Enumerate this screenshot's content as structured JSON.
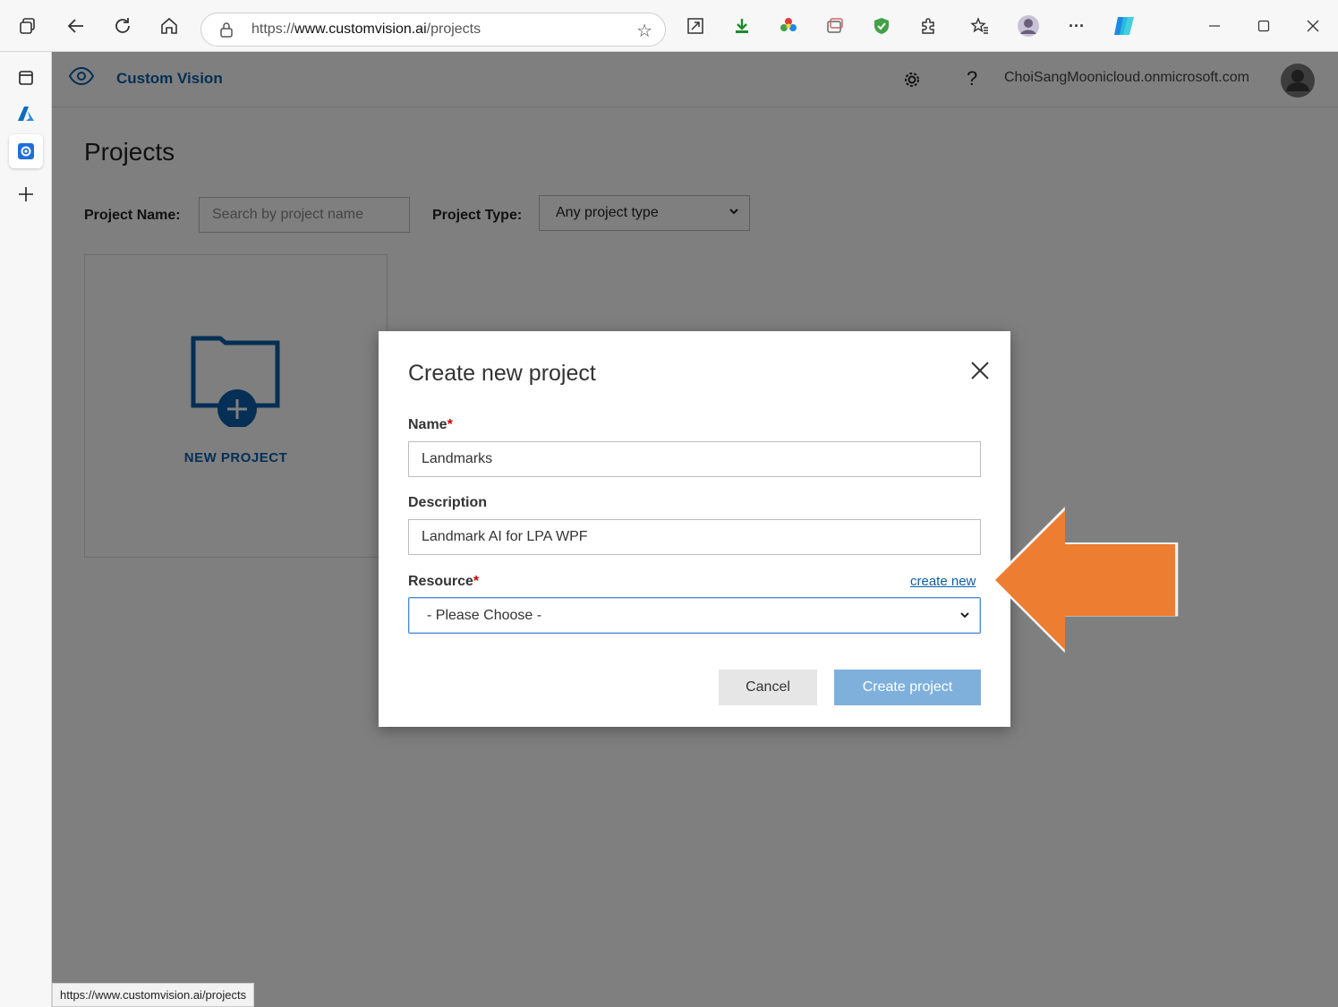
{
  "browser": {
    "url_prefix": "https://",
    "url_domain": "www.customvision.ai",
    "url_path": "/projects",
    "status_url": "https://www.customvision.ai/projects"
  },
  "app": {
    "name": "Custom Vision",
    "user": "ChoiSangMoonicloud.onmicrosoft.com",
    "page_title": "Projects",
    "filter_name_label": "Project Name:",
    "search_placeholder": "Search by project name",
    "filter_type_label": "Project Type:",
    "type_selected": "Any project type",
    "new_project_label": "NEW PROJECT"
  },
  "modal": {
    "title": "Create new project",
    "name_label": "Name",
    "name_value": "Landmarks",
    "description_label": "Description",
    "description_value": "Landmark AI for LPA WPF",
    "resource_label": "Resource",
    "required_mark": "*",
    "create_new_link": "create new",
    "resource_selected": "- Please Choose -",
    "cancel_label": "Cancel",
    "create_label": "Create project"
  },
  "colors": {
    "accent": "#0a5ea8",
    "arrow": "#ed7d31",
    "create_button": "#7fb0dc"
  },
  "icons": [
    "tab-actions-icon",
    "back-icon",
    "refresh-icon",
    "home-icon",
    "lock-icon",
    "favorite-star-icon",
    "expand-icon",
    "download-icon",
    "color-wheel-icon",
    "collections-icon",
    "shield-icon",
    "extensions-icon",
    "favorites-icon",
    "profile-icon",
    "more-icon",
    "copilot-icon",
    "minimize-icon",
    "maximize-icon",
    "close-icon",
    "eye-icon",
    "gear-icon",
    "help-icon",
    "avatar-icon",
    "folder-plus-icon",
    "chevron-down-icon"
  ]
}
